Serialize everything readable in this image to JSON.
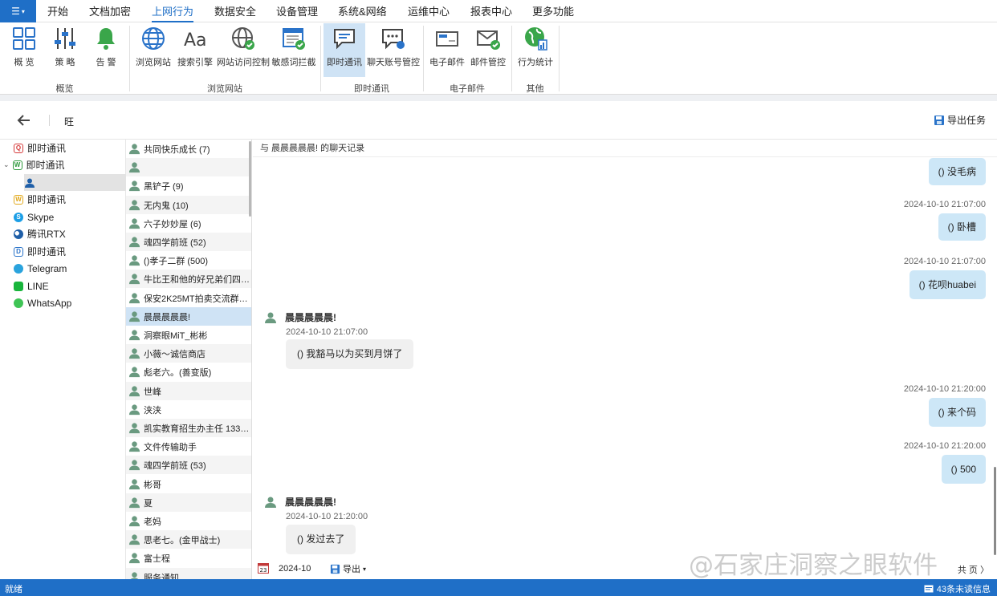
{
  "menu": {
    "app_menu_glyph": "☰",
    "tabs": [
      "开始",
      "文档加密",
      "上网行为",
      "数据安全",
      "设备管理",
      "系统&网络",
      "运维中心",
      "报表中心",
      "更多功能"
    ]
  },
  "ribbon": {
    "buttons": [
      "概 览",
      "策 略",
      "告 警",
      "浏览网站",
      "搜索引擎",
      "网站访问控制",
      "敏感词拦截",
      "即时通讯",
      "聊天账号管控",
      "电子邮件",
      "邮件管控",
      "行为统计"
    ],
    "groups": [
      "概览",
      "浏览网站",
      "即时通讯",
      "电子邮件",
      "其他"
    ]
  },
  "toolbar": {
    "breadcrumb": "旺",
    "export_task": "导出任务"
  },
  "tree": {
    "nodes": [
      "即时通讯",
      "即时通讯",
      "",
      "即时通讯",
      "Skype",
      "腾讯RTX",
      "即时通讯",
      "Telegram",
      "LINE",
      "WhatsApp"
    ],
    "icon_letters": [
      "Q",
      "W",
      "",
      "W",
      "S",
      "",
      "D",
      "",
      "",
      ""
    ]
  },
  "contacts": [
    "共同快乐成长 (7)",
    "",
    "黑铲子 (9)",
    "无内鬼 (10)",
    "六子妙妙屋 (6)",
    "魂四学前班 (52)",
    "()孝子二群 (500)",
    "牛比王和他的好兄弟们四群...",
    "保安2K25MT拍卖交流群㊙...",
    "晨晨晨晨晨!",
    "洞察眼MiT_彬彬",
    "小薇～诚信商店",
    "彪老六。(善变版)",
    "世峰",
    "浃浃",
    "凯实教育招生办主任 1337...",
    "文件传输助手",
    "魂四学前班 (53)",
    "彬哥",
    "夏",
    "老妈",
    "思老七。(金甲战士)",
    "富士程",
    "服务通知"
  ],
  "chat": {
    "title": "与 晨晨晨晨晨!  的聊天记录",
    "messages": [
      {
        "side": "right",
        "time": "",
        "text": "() 没毛病"
      },
      {
        "side": "right",
        "time": "2024-10-10 21:07:00",
        "text": "() 卧槽"
      },
      {
        "side": "right",
        "time": "2024-10-10 21:07:00",
        "text": "() 花呗huabei"
      },
      {
        "side": "left",
        "sender": "晨晨晨晨晨!",
        "time": "2024-10-10 21:07:00",
        "text": "() 我豁马以为买到月饼了"
      },
      {
        "side": "right",
        "time": "2024-10-10 21:20:00",
        "text": "() 来个码"
      },
      {
        "side": "right",
        "time": "2024-10-10 21:20:00",
        "text": "() 500"
      },
      {
        "side": "left",
        "sender": "晨晨晨晨晨!",
        "time": "2024-10-10 21:20:00",
        "text": "() 发过去了"
      }
    ],
    "footer": {
      "calendar_day": "23",
      "date": "2024-10",
      "export": "导出",
      "pager": "共 页 〉"
    }
  },
  "watermark": "@石家庄洞察之眼软件",
  "status": {
    "left": "就绪",
    "right": "43条未读信息"
  },
  "colors": {
    "accent": "#1f6fc7",
    "bubble_self": "#cde7f7",
    "bubble_other": "#f0f0f0",
    "selected": "#cfe3f5"
  }
}
